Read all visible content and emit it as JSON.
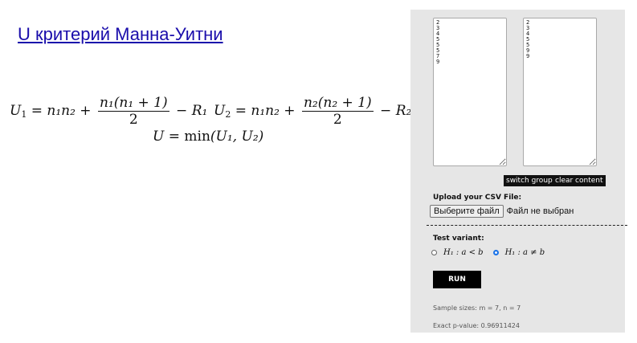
{
  "page": {
    "title": "U критерий Манна-Уитни"
  },
  "formula": {
    "u1_lhs": "U",
    "u1_sub": "1",
    "u1_rhs": " = n₁n₂ +",
    "u1_num": "n₁(n₁ + 1)",
    "u1_den": "2",
    "u1_tail": "− R₁",
    "u2_lhs": "U",
    "u2_sub": "2",
    "u2_rhs": " = n₁n₂ +",
    "u2_num": "n₂(n₂ + 1)",
    "u2_den": "2",
    "u2_tail": "− R₂",
    "u_line_lhs": "U = ",
    "u_line_min": "min",
    "u_line_args": "(U₁, U₂)"
  },
  "panel": {
    "group1_values": "2\n3\n4\n5\n5\n5\n7\n9",
    "group2_values": "2\n3\n4\n5\n5\n9\n9",
    "switch_groups_label": "switch groups",
    "clear_content_label": "clear content",
    "upload_label": "Upload your CSV File:",
    "file_button_label": "Выберите файл",
    "file_status": "Файл не выбран",
    "test_variant_label": "Test variant:",
    "option_less": "H₁ : a < b",
    "option_neq": "H₁ : a ≠ b",
    "selected_option": "neq",
    "run_label": "RUN",
    "sample_sizes": "Sample sizes: m = 7, n = 7",
    "p_value": "Exact p-value: 0.96911424"
  },
  "colors": {
    "title_link": "#1a0dab",
    "panel_bg": "#e6e6e6",
    "button_dark": "#111111",
    "radio_selected": "#1a73e8"
  }
}
